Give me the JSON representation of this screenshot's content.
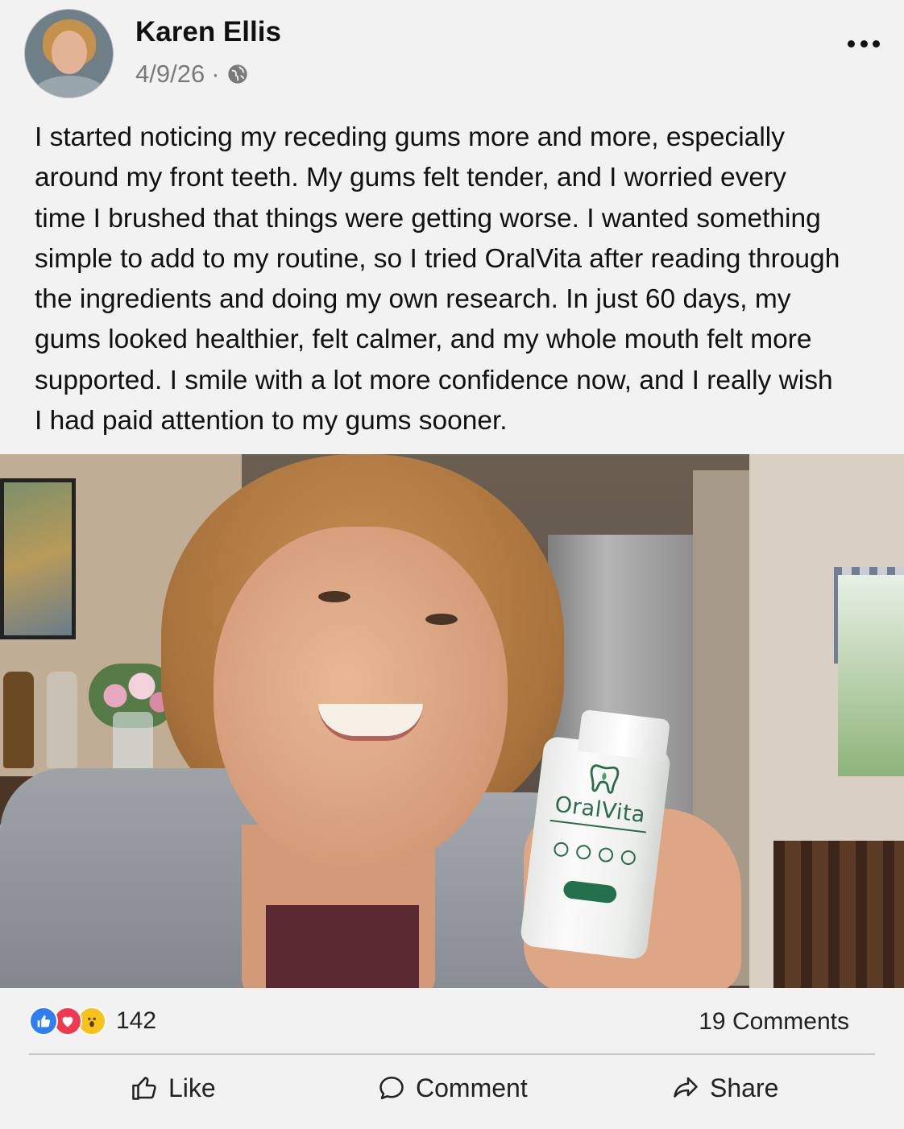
{
  "author": {
    "name": "Karen Ellis",
    "date": "4/9/26",
    "separator": "·",
    "audience_icon": "globe-icon"
  },
  "post": {
    "text_lines": [
      "I started noticing my receding gums more and more, especially",
      "around my front teeth. My gums felt tender, and I worried every",
      "time I brushed that things were getting worse. I wanted something",
      "simple to add to my routine, so I tried OralVita after reading through",
      "the ingredients and doing my own research. In just 60 days, my",
      "gums looked healthier, felt calmer, and my whole mouth felt more",
      "supported. I smile with a lot more confidence now, and I really wish",
      "I had paid attention to my gums sooner."
    ],
    "photo_product_label": "OralVita"
  },
  "reactions": {
    "types": [
      "like",
      "love",
      "wow"
    ],
    "count": "142",
    "comments": "19 Comments"
  },
  "actions": {
    "like": "Like",
    "comment": "Comment",
    "share": "Share"
  },
  "colors": {
    "like_blue": "#2f7ff2",
    "love_red": "#f0394e",
    "wow_yellow": "#f7c21a",
    "product_green": "#2b6b4a"
  }
}
